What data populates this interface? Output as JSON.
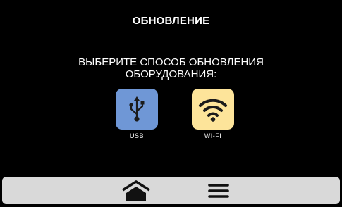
{
  "header": {
    "title": "ОБНОВЛЕНИЕ"
  },
  "prompt": {
    "line1": "ВЫБЕРИТЕ СПОСОБ ОБНОВЛЕНИЯ",
    "line2": "ОБОРУДОВАНИЯ:"
  },
  "options": [
    {
      "label": "USB",
      "icon": "usb-icon",
      "tile_color": "#6f97d6"
    },
    {
      "label": "WI-FI",
      "icon": "wifi-icon",
      "tile_color": "#fde49a"
    }
  ],
  "navbar": {
    "background": "#d9d9d9",
    "home_icon": "home-icon",
    "menu_icon": "menu-icon"
  },
  "colors": {
    "background": "#000000",
    "text": "#ffffff",
    "icon_dark": "#1b1b1b"
  }
}
